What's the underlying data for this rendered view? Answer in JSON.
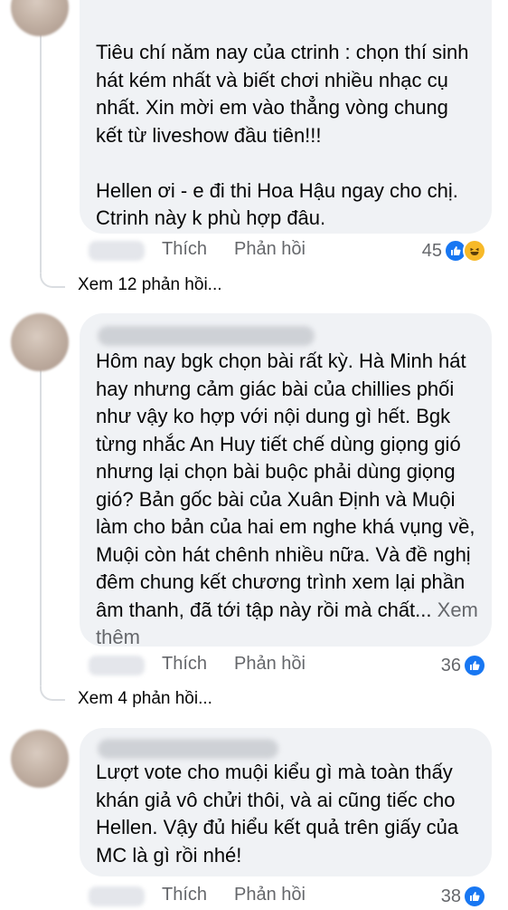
{
  "comments": [
    {
      "text": "Tiêu chí năm nay của ctrinh : chọn thí sinh hát kém nhất và biết chơi nhiều nhạc cụ nhất. Xin mời em vào thẳng vòng chung kết từ liveshow đầu tiên!!!\n\nHellen ơi - e đi thi Hoa Hậu ngay cho chị. Ctrinh này k phù hợp đâu.",
      "like_label": "Thích",
      "reply_label": "Phản hồi",
      "reaction_count": "45",
      "reactions": [
        "like-icon",
        "haha-icon"
      ],
      "view_replies": "Xem 12 phản hồi..."
    },
    {
      "text": "Hôm nay bgk chọn bài rất kỳ. Hà Minh hát hay nhưng cảm giác bài của chillies phối như vậy ko hợp với nội dung gì hết. Bgk từng nhắc An Huy tiết chế dùng giọng gió nhưng lại chọn bài buộc phải dùng giọng gió? Bản gốc bài của Xuân Định và Muội làm cho bản của hai em nghe khá vụng về, Muội còn hát chênh nhiều nữa. Và đề nghị đêm chung kết chương trình xem lại phần âm thanh, đã tới tập này rồi mà chất...",
      "see_more": "Xem thêm",
      "like_label": "Thích",
      "reply_label": "Phản hồi",
      "reaction_count": "36",
      "reactions": [
        "like-icon"
      ],
      "view_replies": "Xem 4 phản hồi..."
    },
    {
      "text": "Lượt vote cho muội kiểu gì mà toàn thấy khán giả vô chửi thôi, và ai cũng tiếc cho Hellen. Vậy đủ hiểu kết quả trên giấy của MC là gì rồi nhé!",
      "like_label": "Thích",
      "reply_label": "Phản hồi",
      "reaction_count": "38",
      "reactions": [
        "like-icon"
      ]
    }
  ],
  "colors": {
    "bubble": "#f0f2f5",
    "secondary_text": "#65676b",
    "like_blue": "#1877f2",
    "haha_yellow": "#f7b928"
  }
}
